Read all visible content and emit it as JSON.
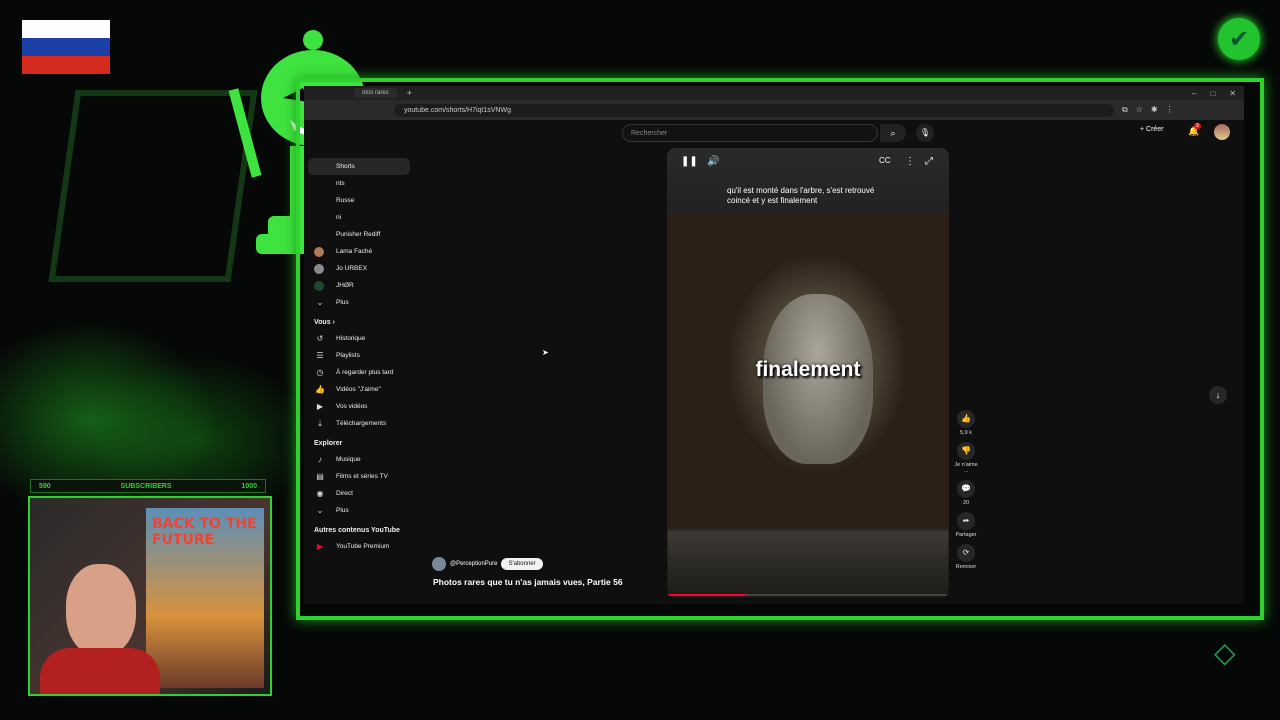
{
  "overlay": {
    "sub_left": "590",
    "sub_label": "SUBSCRIBERS",
    "sub_right": "1000",
    "poster_title": "BACK TO THE FUTURE",
    "flag_colors": [
      "#ffffff",
      "#1c3fa8",
      "#d52b1e"
    ]
  },
  "browser": {
    "tab_label": "otos rares",
    "url": "youtube.com/shorts/H7iqt1sVNWg"
  },
  "youtube": {
    "search_placeholder": "Rechercher",
    "create_label": "Créer",
    "notif_count": "9",
    "sidebar": {
      "top_items": [
        {
          "label": "Shorts",
          "icon": "shorts-icon"
        }
      ],
      "subs_items": [
        {
          "label": "nts"
        },
        {
          "label": "Russe"
        },
        {
          "label": "ni"
        },
        {
          "label": "Punisher Rediff"
        },
        {
          "label": "Lama Faché"
        },
        {
          "label": "Jo URBEX"
        },
        {
          "label": "JHØR"
        },
        {
          "label": "Plus"
        }
      ],
      "vous_header": "Vous",
      "vous_items": [
        {
          "label": "Historique",
          "icon": "history-icon"
        },
        {
          "label": "Playlists",
          "icon": "playlist-icon"
        },
        {
          "label": "À regarder plus tard",
          "icon": "clock-icon"
        },
        {
          "label": "Vidéos \"J'aime\"",
          "icon": "thumb-up-icon"
        },
        {
          "label": "Vos vidéos",
          "icon": "video-icon"
        },
        {
          "label": "Téléchargements",
          "icon": "download-icon"
        }
      ],
      "explorer_header": "Explorer",
      "explorer_items": [
        {
          "label": "Musique",
          "icon": "music-icon"
        },
        {
          "label": "Films et séries TV",
          "icon": "film-icon"
        },
        {
          "label": "Direct",
          "icon": "live-icon"
        },
        {
          "label": "Plus",
          "icon": "chevron-down-icon"
        }
      ],
      "other_header": "Autres contenus YouTube",
      "other_item": "YouTube Premium"
    },
    "short": {
      "subtitle": "qu'il est monté dans l'arbre, s'est retrouvé coincé et y est finalement",
      "caption": "finalement",
      "channel": "@PerceptionPure",
      "subscribe_label": "S'abonner",
      "title": "Photos rares que tu n'as jamais vues, Partie 56",
      "progress": 0.28
    },
    "actions": {
      "likes": "5,9 k",
      "dislike": "Je n'aime ...",
      "comments": "20",
      "share": "Partager",
      "remix": "Remixer"
    }
  }
}
